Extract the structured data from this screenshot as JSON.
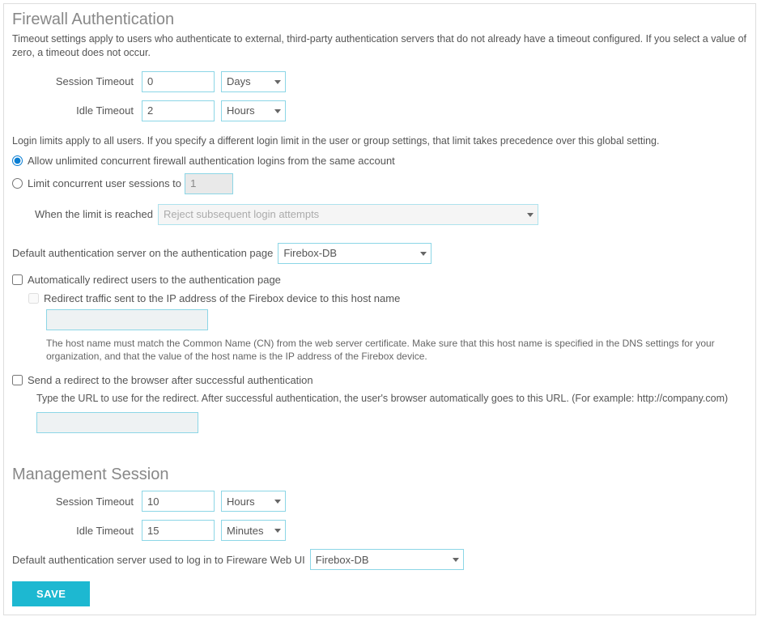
{
  "firewall": {
    "title": "Firewall Authentication",
    "description": "Timeout settings apply to users who authenticate to external, third-party authentication servers that do not already have a timeout configured. If you select a value of zero, a timeout does not occur.",
    "session_timeout_label": "Session Timeout",
    "session_timeout_value": "0",
    "session_timeout_unit": "Days",
    "idle_timeout_label": "Idle Timeout",
    "idle_timeout_value": "2",
    "idle_timeout_unit": "Hours",
    "login_limits_note": "Login limits apply to all users. If you specify a different login limit in the user or group settings, that limit takes precedence over this global setting.",
    "allow_unlimited_label": "Allow unlimited concurrent firewall authentication logins from the same account",
    "limit_concurrent_label": "Limit concurrent user sessions to",
    "limit_concurrent_value": "1",
    "when_limit_label": "When the limit is reached",
    "when_limit_value": "Reject subsequent login attempts",
    "default_auth_label": "Default authentication server on the authentication page",
    "default_auth_value": "Firebox-DB",
    "auto_redirect_label": "Automatically redirect users to the authentication page",
    "redirect_traffic_label": "Redirect traffic sent to the IP address of the Firebox device to this host name",
    "hostname_hint": "The host name must match the Common Name (CN) from the web server certificate. Make sure that this host name is specified in the DNS settings for your organization, and that the value of the host name is the IP address of the Firebox device.",
    "send_redirect_label": "Send a redirect to the browser after successful authentication",
    "send_redirect_hint": "Type the URL to use for the redirect. After successful authentication, the user's browser automatically goes to this URL. (For example: http://company.com)"
  },
  "management": {
    "title": "Management Session",
    "session_timeout_label": "Session Timeout",
    "session_timeout_value": "10",
    "session_timeout_unit": "Hours",
    "idle_timeout_label": "Idle Timeout",
    "idle_timeout_value": "15",
    "idle_timeout_unit": "Minutes",
    "webui_auth_label": "Default authentication server used to log in to Fireware Web UI",
    "webui_auth_value": "Firebox-DB"
  },
  "buttons": {
    "save": "SAVE"
  }
}
